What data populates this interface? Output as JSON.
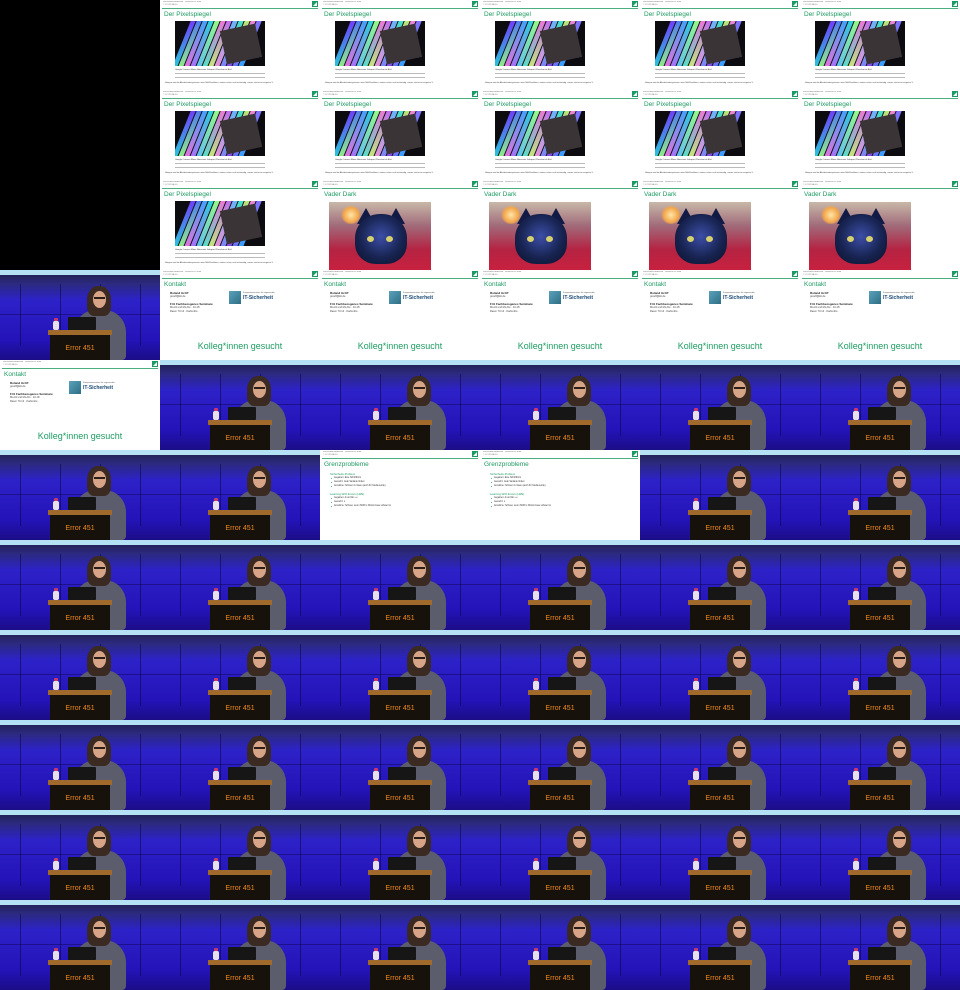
{
  "slides": {
    "header_lines": [
      "Rechenbetriebsbetrieb · Gesehen für Studi",
      "© CC BY-SA 4.0"
    ],
    "pixel_title": "Der Pixelspiegel",
    "pixel_caption": "Google Camera Moire Bitmuster Subpixel Pinselstrich Bild",
    "pixel_text": "Hängen sind die Alterbetriebssystemen unter Bild-Realitäten, sodass schon nicht notwendig, nutzen sind unter vorgetan 3.",
    "cat_title": "Vader Dark",
    "contact_title": "Kontakt",
    "contact_name": "Roland Gröff",
    "contact_mail": "groeff@kit.de",
    "contact_fach": "F41 Fachbezogenes Seminare",
    "contact_time": "Mo-Di und Mo-Do · 10-18",
    "contact_room": "Raum 70.14 · Karlsruhe",
    "kit_small": "Kompetenzzentrum für angewandte",
    "kit_big": "IT-Sicherheit",
    "kolleg": "Kolleg*innen gesucht",
    "lists_title": "Grenzprobleme",
    "lists_items": [
      {
        "type": "h",
        "text": "Sicherheits-Problem"
      },
      {
        "type": "b",
        "text": "Gegeben: Eine Schriftform"
      },
      {
        "type": "b",
        "text": "Gesucht: Jede Variante finden"
      },
      {
        "type": "b",
        "text": "Annahme: Schwer zu lösen (auch für Studierende)"
      },
      {
        "type": "h",
        "text": "Learning With Errors (LWE)"
      },
      {
        "type": "b",
        "text": "Gegeben: A und Ab + e"
      },
      {
        "type": "b",
        "text": "Gesucht: s"
      },
      {
        "type": "b",
        "text": "Annahme: Schwer, wenn SNR in Worst-Case schwer ist"
      }
    ]
  },
  "stage_label": "Error 451",
  "tiles": [
    [
      "black",
      "pixel",
      "pixel",
      "pixel",
      "pixel",
      "pixel"
    ],
    [
      "black",
      "pixel",
      "pixel",
      "pixel",
      "pixel",
      "pixel"
    ],
    [
      "black",
      "pixel",
      "cat",
      "cat",
      "cat",
      "cat"
    ],
    [
      "stage",
      "contact",
      "contact",
      "contact",
      "contact",
      "contact"
    ],
    [
      "contact",
      "stage",
      "stage",
      "stage",
      "stage",
      "stage"
    ],
    [
      "stage",
      "stage",
      "lists",
      "lists",
      "stage",
      "stage"
    ],
    [
      "stage",
      "stage",
      "stage",
      "stage",
      "stage",
      "stage"
    ],
    [
      "stage",
      "stage",
      "stage",
      "stage",
      "stage",
      "stage"
    ],
    [
      "stage",
      "stage",
      "stage",
      "stage",
      "stage",
      "stage"
    ],
    [
      "stage",
      "stage",
      "stage",
      "stage",
      "stage",
      "stage"
    ],
    [
      "stage",
      "stage",
      "stage",
      "stage",
      "stage",
      "stage"
    ]
  ],
  "colors": {
    "slide_accent": "#1d9a62",
    "stage_blue": "#2413b8",
    "label_orange": "#f08a1e"
  }
}
